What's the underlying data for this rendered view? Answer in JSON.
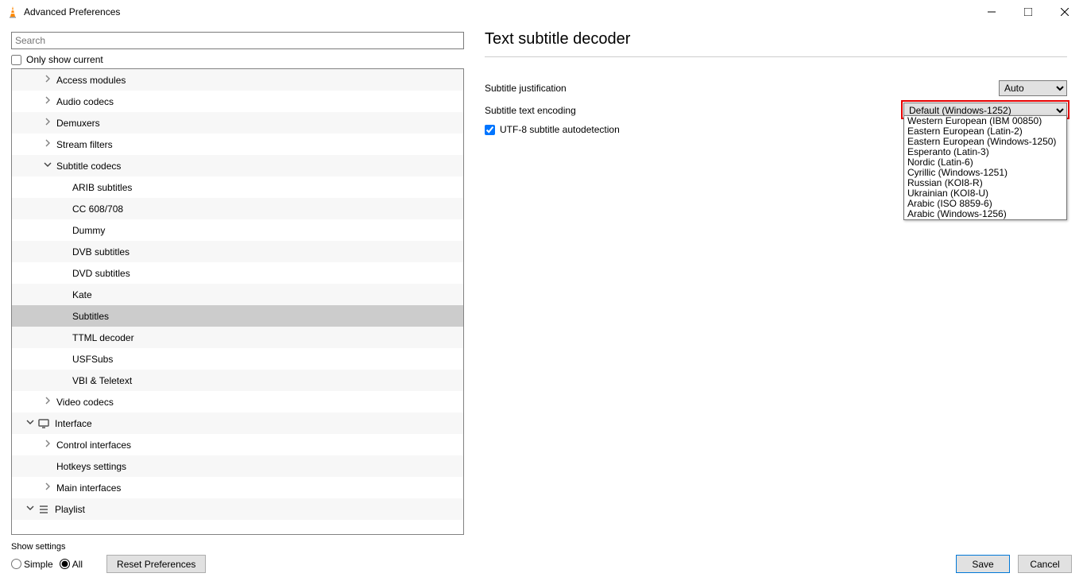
{
  "window": {
    "title": "Advanced Preferences"
  },
  "search": {
    "placeholder": "Search"
  },
  "only_show_current": "Only show current",
  "tree": {
    "items": [
      {
        "label": "Access modules",
        "chev": "right",
        "indent": 1
      },
      {
        "label": "Audio codecs",
        "chev": "right",
        "indent": 1
      },
      {
        "label": "Demuxers",
        "chev": "right",
        "indent": 1
      },
      {
        "label": "Stream filters",
        "chev": "right",
        "indent": 1
      },
      {
        "label": "Subtitle codecs",
        "chev": "down",
        "indent": 1
      },
      {
        "label": "ARIB subtitles",
        "chev": "",
        "indent": 2
      },
      {
        "label": "CC 608/708",
        "chev": "",
        "indent": 2
      },
      {
        "label": "Dummy",
        "chev": "",
        "indent": 2
      },
      {
        "label": "DVB subtitles",
        "chev": "",
        "indent": 2
      },
      {
        "label": "DVD subtitles",
        "chev": "",
        "indent": 2
      },
      {
        "label": "Kate",
        "chev": "",
        "indent": 2
      },
      {
        "label": "Subtitles",
        "chev": "",
        "indent": 2,
        "selected": true
      },
      {
        "label": "TTML decoder",
        "chev": "",
        "indent": 2
      },
      {
        "label": "USFSubs",
        "chev": "",
        "indent": 2
      },
      {
        "label": "VBI & Teletext",
        "chev": "",
        "indent": 2
      },
      {
        "label": "Video codecs",
        "chev": "right",
        "indent": 1
      },
      {
        "label": "Interface",
        "chev": "down",
        "indent": 0,
        "icon": "interface"
      },
      {
        "label": "Control interfaces",
        "chev": "right",
        "indent": 1
      },
      {
        "label": "Hotkeys settings",
        "chev": "",
        "indent": 1
      },
      {
        "label": "Main interfaces",
        "chev": "right",
        "indent": 1
      },
      {
        "label": "Playlist",
        "chev": "down",
        "indent": 0,
        "icon": "playlist"
      }
    ]
  },
  "pane": {
    "title": "Text subtitle decoder",
    "justification_label": "Subtitle justification",
    "justification_value": "Auto",
    "encoding_label": "Subtitle text encoding",
    "encoding_value": "Default (Windows-1252)",
    "utf8_label": "UTF-8 subtitle autodetection",
    "encoding_options": [
      "Western European (IBM 00850)",
      "Eastern European (Latin-2)",
      "Eastern European (Windows-1250)",
      "Esperanto (Latin-3)",
      "Nordic (Latin-6)",
      "Cyrillic (Windows-1251)",
      "Russian (KOI8-R)",
      "Ukrainian (KOI8-U)",
      "Arabic (ISO 8859-6)",
      "Arabic (Windows-1256)"
    ]
  },
  "bottom": {
    "show_settings": "Show settings",
    "simple": "Simple",
    "all": "All",
    "reset": "Reset Preferences",
    "save": "Save",
    "cancel": "Cancel"
  }
}
